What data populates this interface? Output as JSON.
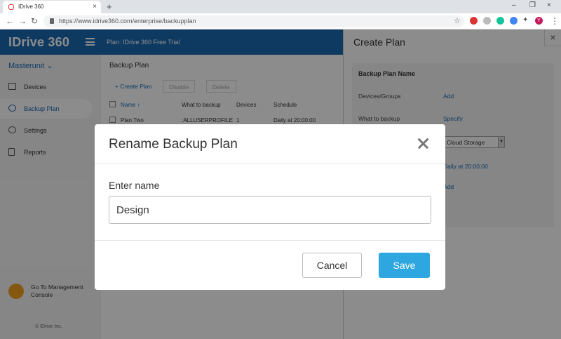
{
  "browser": {
    "tab_title": "IDrive 360",
    "tab_close": "×",
    "new_tab": "+",
    "url": "https://www.idrive360.com/enterprise/backupplan",
    "profile_initial": "Y",
    "window_controls": [
      "–",
      "❐",
      "×"
    ]
  },
  "app": {
    "logo": "IDrive 360",
    "plan_label": "Plan: IDrive 360 Free Trial",
    "org_name": "Masterunit",
    "sidebar": [
      {
        "label": "Devices",
        "icon": "monitor-icon"
      },
      {
        "label": "Backup Plan",
        "icon": "cloud-icon",
        "active": true
      },
      {
        "label": "Settings",
        "icon": "gear-icon"
      },
      {
        "label": "Reports",
        "icon": "document-icon"
      }
    ],
    "console_label": "Go To Management Console",
    "copyright": "© IDrive Inc."
  },
  "main": {
    "title": "Backup Plan",
    "toolbar": {
      "create": "+ Create Plan",
      "disable": "Disable",
      "delete": "Delete"
    },
    "columns": [
      "Name ↑",
      "What to backup",
      "Devices",
      "Schedule"
    ],
    "rows": [
      {
        "name": "Plan Two",
        "what": ":ALLUSERPROFILE",
        "devices": "1",
        "schedule": "Daily at 20:00:00"
      }
    ]
  },
  "create_panel": {
    "title": "Create Plan",
    "close": "×",
    "section_title": "Backup Plan Name",
    "devices_label": "Devices/Groups",
    "devices_action": "Add",
    "what_label": "What to backup",
    "what_action": "Specify",
    "destination_value": "Cloud Storage",
    "schedule_value": "Daily at 20:00:00",
    "add_action": "Add"
  },
  "modal": {
    "title": "Rename Backup Plan",
    "field_label": "Enter name",
    "field_value": "Design",
    "cancel_label": "Cancel",
    "save_label": "Save",
    "colors": {
      "save_bg": "#2ea6df",
      "brand": "#1b6bb3"
    }
  }
}
